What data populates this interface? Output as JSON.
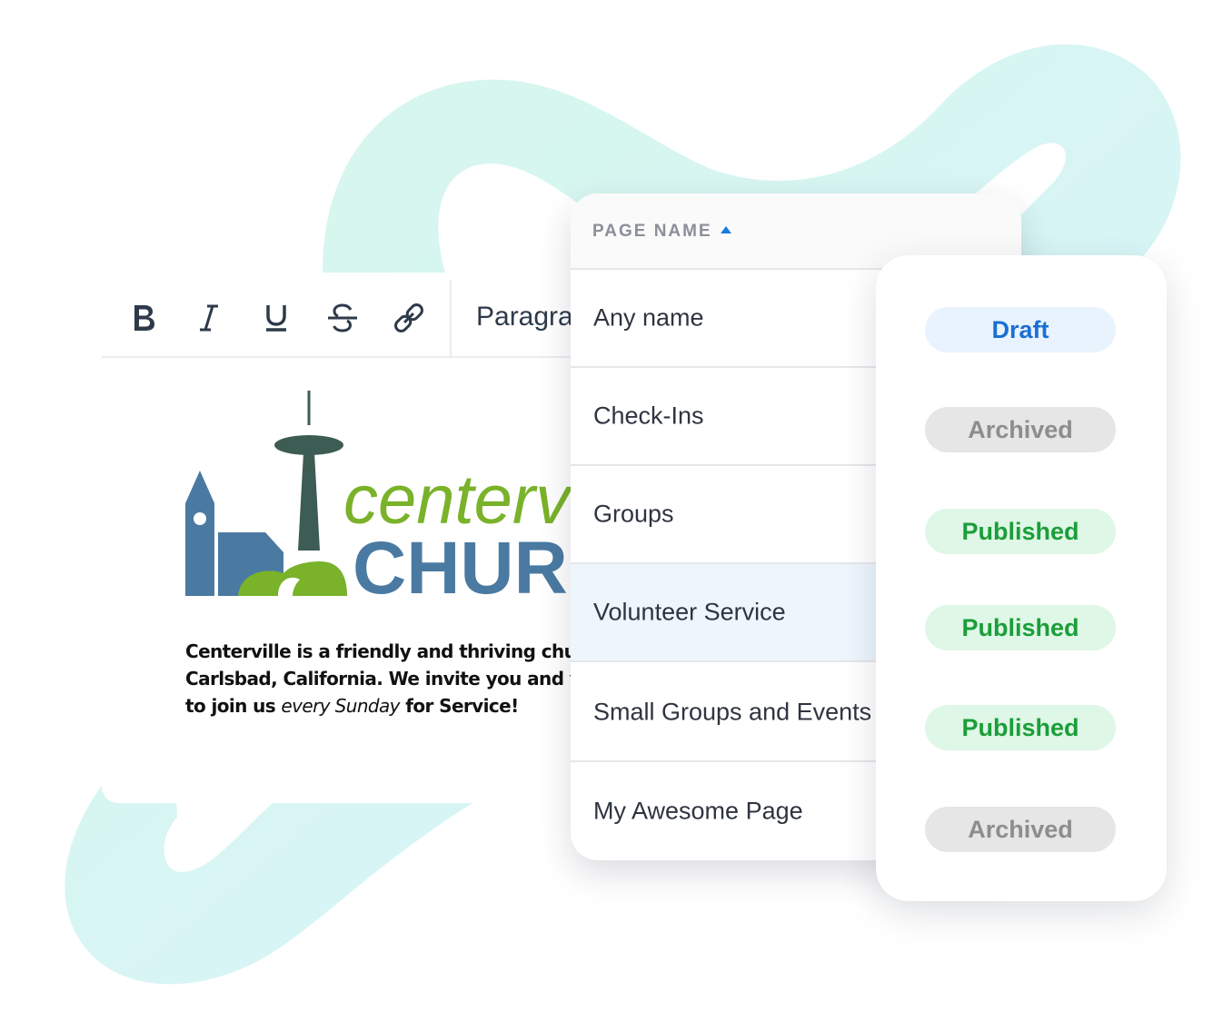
{
  "colors": {
    "ribbon_green": "#d6f7ec",
    "ribbon_blue": "#d8f4fb",
    "logo_blue": "#4a7aa2",
    "logo_green": "#7ab22a",
    "logo_tower": "#3d5c53",
    "draft": "#1a6fd4",
    "published": "#1b9e3a",
    "archived": "#8d8d8d"
  },
  "editor": {
    "toolbar": {
      "icons": [
        "bold-icon",
        "italic-icon",
        "underline-icon",
        "strikethrough-icon",
        "link-icon"
      ],
      "format_label": "Paragraph"
    },
    "logo": {
      "line1": "centerville",
      "line2": "CHURCH"
    },
    "body": {
      "line1": "Centerville is a friendly and thriving church in",
      "line2": "Carlsbad, California. We invite you and your family",
      "line3_before": "to join us ",
      "line3_em": "every Sunday",
      "line3_after": " for Service!"
    }
  },
  "table": {
    "column_header": "PAGE NAME",
    "sort": "ascending",
    "rows": [
      {
        "name": "Any name",
        "status": "Draft"
      },
      {
        "name": "Check-Ins",
        "status": "Archived"
      },
      {
        "name": "Groups",
        "status": "Published"
      },
      {
        "name": "Volunteer Service",
        "status": "Published",
        "selected": true
      },
      {
        "name": "Small Groups and Events",
        "status": "Published"
      },
      {
        "name": "My Awesome Page",
        "status": "Archived"
      }
    ]
  }
}
